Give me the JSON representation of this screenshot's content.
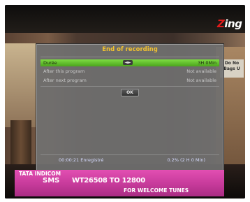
{
  "channel": {
    "logo": "Zing",
    "logo_accent": "Z",
    "logo_rest": "ing"
  },
  "background": {
    "board_text": "Do No Bags U"
  },
  "dialog": {
    "title": "End of recording",
    "options": [
      {
        "label": "Durée",
        "value": "3H 0Min",
        "selected": true,
        "adjust_glyph": "◄►"
      },
      {
        "label": "After this program",
        "value": "Not available",
        "selected": false
      },
      {
        "label": "After next program",
        "value": "Not available",
        "selected": false
      }
    ],
    "ok_label": "OK",
    "status": {
      "elapsed": "00:00:21 Enregistré",
      "progress": "0.2%  (2 H 0 Min)"
    }
  },
  "ad": {
    "brand": "TATA INDICOM",
    "sms": "SMS",
    "code": "WT26508 TO 12800",
    "tagline": "FOR WELCOME TUNES",
    "color": "#d446a6"
  }
}
